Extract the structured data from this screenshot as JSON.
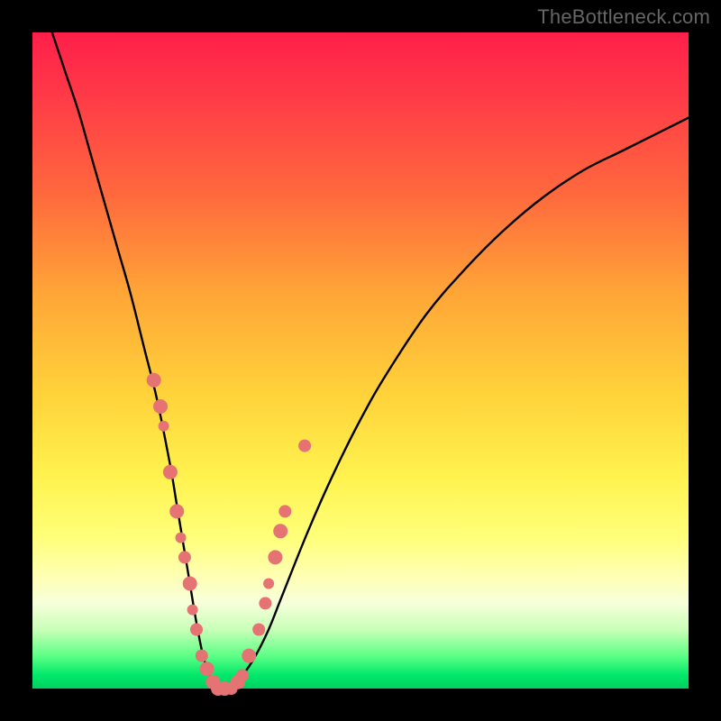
{
  "watermark": "TheBottleneck.com",
  "chart_data": {
    "type": "line",
    "title": "",
    "xlabel": "",
    "ylabel": "",
    "xlim": [
      0,
      100
    ],
    "ylim": [
      0,
      100
    ],
    "background_gradient": {
      "top": "#ff1f4a",
      "mid": "#ffe24a",
      "bottom": "#00d060"
    },
    "series": [
      {
        "name": "bottleneck-curve",
        "x": [
          3,
          5,
          7,
          9,
          11,
          13,
          15,
          17,
          19,
          21,
          22,
          23,
          24,
          25,
          26,
          27,
          28,
          29,
          30,
          32,
          34,
          36,
          38,
          42,
          46,
          50,
          54,
          60,
          66,
          72,
          78,
          84,
          90,
          96,
          100
        ],
        "y": [
          100,
          94,
          88,
          81,
          74,
          67,
          60,
          52,
          44,
          34,
          28,
          22,
          16,
          10,
          5,
          2,
          0,
          0,
          0,
          2,
          5,
          9,
          14,
          24,
          33,
          41,
          48,
          57,
          64,
          70,
          75,
          79,
          82,
          85,
          87
        ]
      }
    ],
    "scatter": {
      "name": "data-points",
      "color": "#e57373",
      "points": [
        {
          "x": 18.5,
          "y": 47,
          "r": 8
        },
        {
          "x": 19.5,
          "y": 43,
          "r": 8
        },
        {
          "x": 20.0,
          "y": 40,
          "r": 6
        },
        {
          "x": 21.0,
          "y": 33,
          "r": 8
        },
        {
          "x": 22.0,
          "y": 27,
          "r": 8
        },
        {
          "x": 22.6,
          "y": 23,
          "r": 6
        },
        {
          "x": 23.2,
          "y": 20,
          "r": 7
        },
        {
          "x": 24.0,
          "y": 16,
          "r": 8
        },
        {
          "x": 24.4,
          "y": 12,
          "r": 6
        },
        {
          "x": 25.0,
          "y": 9,
          "r": 7
        },
        {
          "x": 25.8,
          "y": 5,
          "r": 7
        },
        {
          "x": 26.6,
          "y": 3,
          "r": 8
        },
        {
          "x": 27.5,
          "y": 1,
          "r": 8
        },
        {
          "x": 28.3,
          "y": 0,
          "r": 8
        },
        {
          "x": 29.3,
          "y": 0,
          "r": 8
        },
        {
          "x": 30.3,
          "y": 0,
          "r": 7
        },
        {
          "x": 31.3,
          "y": 1,
          "r": 8
        },
        {
          "x": 32.0,
          "y": 2,
          "r": 7
        },
        {
          "x": 33.0,
          "y": 5,
          "r": 8
        },
        {
          "x": 34.5,
          "y": 9,
          "r": 7
        },
        {
          "x": 35.5,
          "y": 13,
          "r": 7
        },
        {
          "x": 36.0,
          "y": 16,
          "r": 6
        },
        {
          "x": 37.0,
          "y": 20,
          "r": 8
        },
        {
          "x": 37.8,
          "y": 24,
          "r": 8
        },
        {
          "x": 38.5,
          "y": 27,
          "r": 7
        },
        {
          "x": 41.5,
          "y": 37,
          "r": 7
        }
      ]
    }
  }
}
